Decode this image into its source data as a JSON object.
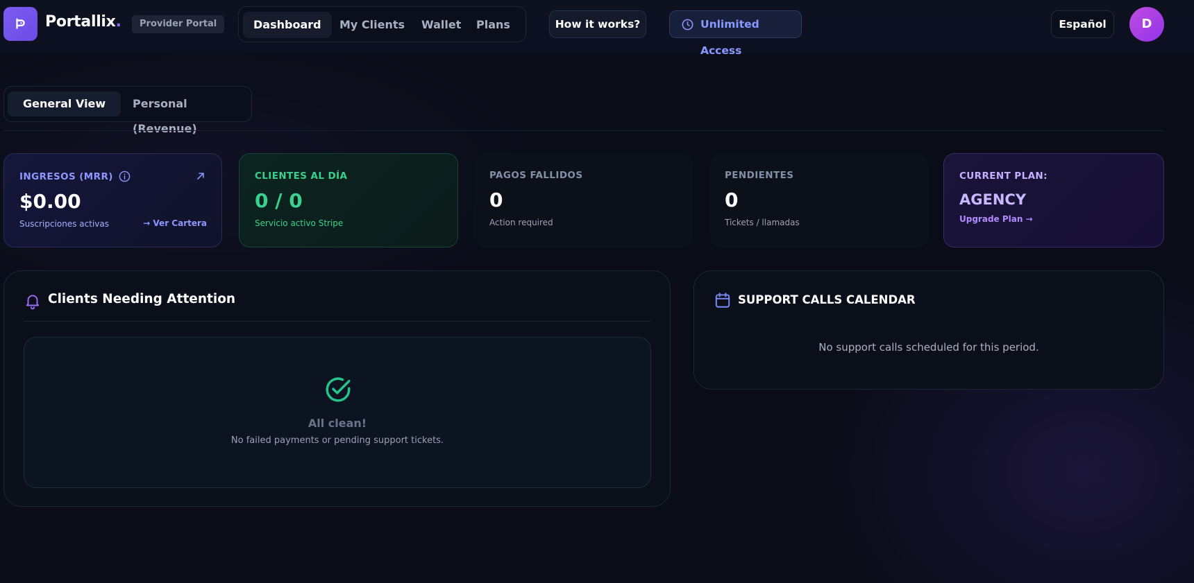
{
  "header": {
    "brand": "Portallix",
    "brand_dot": ".",
    "badge": "Provider Portal",
    "nav": [
      {
        "label": "Dashboard",
        "active": true
      },
      {
        "label": "My Clients",
        "active": false
      },
      {
        "label": "Wallet",
        "active": false
      },
      {
        "label": "Plans",
        "active": false
      }
    ],
    "how_label": "How it works?",
    "access_label": "Unlimited Access",
    "language_label": "Español",
    "avatar_initial": "D"
  },
  "view_toggle": {
    "general": "General View",
    "personal": "Personal (Revenue)"
  },
  "stats": {
    "mrr": {
      "label": "INGRESOS (MRR)",
      "value": "$0.00",
      "sub": "Suscripciones activas",
      "link": "→ Ver Cartera"
    },
    "clients": {
      "label": "CLIENTES AL DÍA",
      "value": "0 / 0",
      "sub": "Servicio activo Stripe"
    },
    "failed": {
      "label": "PAGOS FALLIDOS",
      "value": "0",
      "sub": "Action required"
    },
    "pending": {
      "label": "PENDIENTES",
      "value": "0",
      "sub": "Tickets / llamadas"
    },
    "plan": {
      "label": "CURRENT PLAN:",
      "value": "AGENCY",
      "link": "Upgrade Plan →"
    }
  },
  "attention": {
    "title": "Clients Needing Attention",
    "empty_title": "All clean!",
    "empty_desc": "No failed payments or pending support tickets."
  },
  "calendar": {
    "title": "SUPPORT CALLS CALENDAR",
    "empty": "No support calls scheduled for this period."
  },
  "colors": {
    "accent": "#7c5cf0",
    "success": "#3ad18f",
    "indigo": "#8d97ff"
  }
}
